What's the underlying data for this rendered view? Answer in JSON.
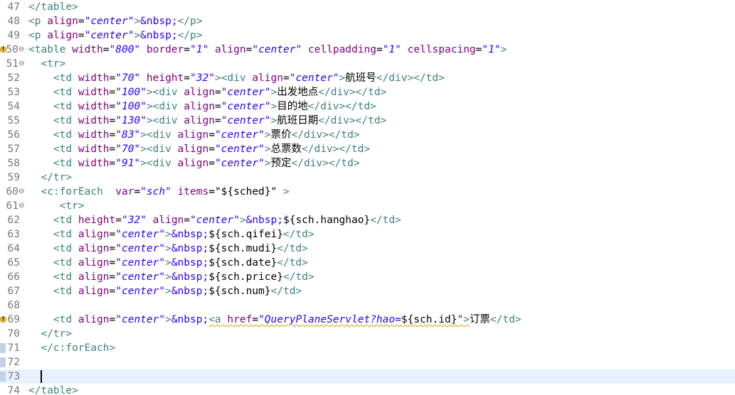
{
  "editor": {
    "caret_line": 72,
    "lines": [
      {
        "num": "47",
        "tokens": [
          [
            "tag",
            "</table>"
          ]
        ]
      },
      {
        "num": "48",
        "tokens": [
          [
            "tag",
            "<p "
          ],
          [
            "attr",
            "align"
          ],
          [
            "txt",
            "="
          ],
          [
            "val",
            "\"center\""
          ],
          [
            "tag",
            ">"
          ],
          [
            "ent",
            "&nbsp;"
          ],
          [
            "tag",
            "</p>"
          ]
        ]
      },
      {
        "num": "49",
        "tokens": [
          [
            "tag",
            "<p "
          ],
          [
            "attr",
            "align"
          ],
          [
            "txt",
            "="
          ],
          [
            "val",
            "\"center\""
          ],
          [
            "tag",
            ">"
          ],
          [
            "ent",
            "&nbsp;"
          ],
          [
            "tag",
            "</p>"
          ]
        ]
      },
      {
        "num": "50",
        "fold": "⊖",
        "warning": true,
        "tokens": [
          [
            "tag",
            "<table "
          ],
          [
            "attr",
            "width"
          ],
          [
            "txt",
            "="
          ],
          [
            "val",
            "\"800\""
          ],
          [
            "txt",
            " "
          ],
          [
            "attr",
            "border"
          ],
          [
            "txt",
            "="
          ],
          [
            "val",
            "\"1\""
          ],
          [
            "txt",
            " "
          ],
          [
            "attr",
            "align"
          ],
          [
            "txt",
            "="
          ],
          [
            "val",
            "\"center\""
          ],
          [
            "txt",
            " "
          ],
          [
            "attr",
            "cellpadding"
          ],
          [
            "txt",
            "="
          ],
          [
            "val",
            "\"1\""
          ],
          [
            "txt",
            " "
          ],
          [
            "attr",
            "cellspacing"
          ],
          [
            "txt",
            "="
          ],
          [
            "val",
            "\"1\""
          ],
          [
            "tag",
            ">"
          ]
        ]
      },
      {
        "num": "51",
        "fold": "⊖",
        "tokens": [
          [
            "txt",
            "  "
          ],
          [
            "tag",
            "<tr>"
          ]
        ]
      },
      {
        "num": "52",
        "tokens": [
          [
            "txt",
            "    "
          ],
          [
            "tag",
            "<td "
          ],
          [
            "attr",
            "width"
          ],
          [
            "txt",
            "="
          ],
          [
            "val",
            "\"70\""
          ],
          [
            "txt",
            " "
          ],
          [
            "attr",
            "height"
          ],
          [
            "txt",
            "="
          ],
          [
            "val",
            "\"32\""
          ],
          [
            "tag",
            "><div "
          ],
          [
            "attr",
            "align"
          ],
          [
            "txt",
            "="
          ],
          [
            "val",
            "\"center\""
          ],
          [
            "tag",
            ">"
          ],
          [
            "txt",
            "航班号"
          ],
          [
            "tag",
            "</div></td>"
          ]
        ]
      },
      {
        "num": "53",
        "tokens": [
          [
            "txt",
            "    "
          ],
          [
            "tag",
            "<td "
          ],
          [
            "attr",
            "width"
          ],
          [
            "txt",
            "="
          ],
          [
            "val",
            "\"100\""
          ],
          [
            "tag",
            "><div "
          ],
          [
            "attr",
            "align"
          ],
          [
            "txt",
            "="
          ],
          [
            "val",
            "\"center\""
          ],
          [
            "tag",
            ">"
          ],
          [
            "txt",
            "出发地点"
          ],
          [
            "tag",
            "</div></td>"
          ]
        ]
      },
      {
        "num": "54",
        "tokens": [
          [
            "txt",
            "    "
          ],
          [
            "tag",
            "<td "
          ],
          [
            "attr",
            "width"
          ],
          [
            "txt",
            "="
          ],
          [
            "val",
            "\"100\""
          ],
          [
            "tag",
            "><div "
          ],
          [
            "attr",
            "align"
          ],
          [
            "txt",
            "="
          ],
          [
            "val",
            "\"center\""
          ],
          [
            "tag",
            ">"
          ],
          [
            "txt",
            "目的地"
          ],
          [
            "tag",
            "</div></td>"
          ]
        ]
      },
      {
        "num": "55",
        "tokens": [
          [
            "txt",
            "    "
          ],
          [
            "tag",
            "<td "
          ],
          [
            "attr",
            "width"
          ],
          [
            "txt",
            "="
          ],
          [
            "val",
            "\"130\""
          ],
          [
            "tag",
            "><div "
          ],
          [
            "attr",
            "align"
          ],
          [
            "txt",
            "="
          ],
          [
            "val",
            "\"center\""
          ],
          [
            "tag",
            ">"
          ],
          [
            "txt",
            "航班日期"
          ],
          [
            "tag",
            "</div></td>"
          ]
        ]
      },
      {
        "num": "56",
        "tokens": [
          [
            "txt",
            "    "
          ],
          [
            "tag",
            "<td "
          ],
          [
            "attr",
            "width"
          ],
          [
            "txt",
            "="
          ],
          [
            "val",
            "\"83\""
          ],
          [
            "tag",
            "><div "
          ],
          [
            "attr",
            "align"
          ],
          [
            "txt",
            "="
          ],
          [
            "val",
            "\"center\""
          ],
          [
            "tag",
            ">"
          ],
          [
            "txt",
            "票价"
          ],
          [
            "tag",
            "</div></td>"
          ]
        ]
      },
      {
        "num": "57",
        "tokens": [
          [
            "txt",
            "    "
          ],
          [
            "tag",
            "<td "
          ],
          [
            "attr",
            "width"
          ],
          [
            "txt",
            "="
          ],
          [
            "val",
            "\"70\""
          ],
          [
            "tag",
            "><div "
          ],
          [
            "attr",
            "align"
          ],
          [
            "txt",
            "="
          ],
          [
            "val",
            "\"center\""
          ],
          [
            "tag",
            ">"
          ],
          [
            "txt",
            "总票数"
          ],
          [
            "tag",
            "</div></td>"
          ]
        ]
      },
      {
        "num": "58",
        "tokens": [
          [
            "txt",
            "    "
          ],
          [
            "tag",
            "<td "
          ],
          [
            "attr",
            "width"
          ],
          [
            "txt",
            "="
          ],
          [
            "val",
            "\"91\""
          ],
          [
            "tag",
            "><div "
          ],
          [
            "attr",
            "align"
          ],
          [
            "txt",
            "="
          ],
          [
            "val",
            "\"center\""
          ],
          [
            "tag",
            ">"
          ],
          [
            "txt",
            "预定"
          ],
          [
            "tag",
            "</div></td>"
          ]
        ]
      },
      {
        "num": "59",
        "tokens": [
          [
            "txt",
            "  "
          ],
          [
            "tag",
            "</tr>"
          ]
        ]
      },
      {
        "num": "60",
        "fold": "⊖",
        "tokens": [
          [
            "txt",
            "  "
          ],
          [
            "tag",
            "<c:forEach  "
          ],
          [
            "attr",
            "var"
          ],
          [
            "txt",
            "="
          ],
          [
            "val",
            "\"sch\""
          ],
          [
            "txt",
            " "
          ],
          [
            "attr",
            "items"
          ],
          [
            "txt",
            "="
          ],
          [
            "txt",
            "\"${sched}\""
          ],
          [
            "tag",
            " >"
          ]
        ]
      },
      {
        "num": "61",
        "fold": "⊖",
        "tokens": [
          [
            "txt",
            "     "
          ],
          [
            "tag",
            "<tr>"
          ]
        ]
      },
      {
        "num": "62",
        "tokens": [
          [
            "txt",
            "    "
          ],
          [
            "tag",
            "<td "
          ],
          [
            "attr",
            "height"
          ],
          [
            "txt",
            "="
          ],
          [
            "val",
            "\"32\""
          ],
          [
            "txt",
            " "
          ],
          [
            "attr",
            "align"
          ],
          [
            "txt",
            "="
          ],
          [
            "val",
            "\"center\""
          ],
          [
            "tag",
            ">"
          ],
          [
            "ent",
            "&nbsp;"
          ],
          [
            "txt",
            "${sch.hanghao}"
          ],
          [
            "tag",
            "</td>"
          ]
        ]
      },
      {
        "num": "63",
        "tokens": [
          [
            "txt",
            "    "
          ],
          [
            "tag",
            "<td "
          ],
          [
            "attr",
            "align"
          ],
          [
            "txt",
            "="
          ],
          [
            "val",
            "\"center\""
          ],
          [
            "tag",
            ">"
          ],
          [
            "ent",
            "&nbsp;"
          ],
          [
            "txt",
            "${sch.qifei}"
          ],
          [
            "tag",
            "</td>"
          ]
        ]
      },
      {
        "num": "64",
        "tokens": [
          [
            "txt",
            "    "
          ],
          [
            "tag",
            "<td "
          ],
          [
            "attr",
            "align"
          ],
          [
            "txt",
            "="
          ],
          [
            "val",
            "\"center\""
          ],
          [
            "tag",
            ">"
          ],
          [
            "ent",
            "&nbsp;"
          ],
          [
            "txt",
            "${sch.mudi}"
          ],
          [
            "tag",
            "</td>"
          ]
        ]
      },
      {
        "num": "65",
        "tokens": [
          [
            "txt",
            "    "
          ],
          [
            "tag",
            "<td "
          ],
          [
            "attr",
            "align"
          ],
          [
            "txt",
            "="
          ],
          [
            "val",
            "\"center\""
          ],
          [
            "tag",
            ">"
          ],
          [
            "ent",
            "&nbsp;"
          ],
          [
            "txt",
            "${sch.date}"
          ],
          [
            "tag",
            "</td>"
          ]
        ]
      },
      {
        "num": "66",
        "tokens": [
          [
            "txt",
            "    "
          ],
          [
            "tag",
            "<td "
          ],
          [
            "attr",
            "align"
          ],
          [
            "txt",
            "="
          ],
          [
            "val",
            "\"center\""
          ],
          [
            "tag",
            ">"
          ],
          [
            "ent",
            "&nbsp;"
          ],
          [
            "txt",
            "${sch.price}"
          ],
          [
            "tag",
            "</td>"
          ]
        ]
      },
      {
        "num": "67",
        "tokens": [
          [
            "txt",
            "    "
          ],
          [
            "tag",
            "<td "
          ],
          [
            "attr",
            "align"
          ],
          [
            "txt",
            "="
          ],
          [
            "val",
            "\"center\""
          ],
          [
            "tag",
            ">"
          ],
          [
            "ent",
            "&nbsp;"
          ],
          [
            "txt",
            "${sch.num}"
          ],
          [
            "tag",
            "</td>"
          ]
        ]
      },
      {
        "num": "68",
        "tokens": []
      },
      {
        "num": "69",
        "warning": true,
        "tokens": [
          [
            "txt",
            "    "
          ],
          [
            "tag",
            "<td "
          ],
          [
            "attr",
            "align"
          ],
          [
            "txt",
            "="
          ],
          [
            "val",
            "\"center\""
          ],
          [
            "tag",
            ">"
          ],
          [
            "ent",
            "&nbsp;"
          ],
          [
            "tag",
            "<a ",
            true
          ],
          [
            "attr",
            "href",
            true
          ],
          [
            "txt",
            "=",
            true
          ],
          [
            "val",
            "\"QueryPlaneServlet?hao=",
            true
          ],
          [
            "txt",
            "${sch.id}",
            true
          ],
          [
            "val",
            "\"",
            true
          ],
          [
            "tag",
            ">",
            true
          ],
          [
            "txt",
            "订票"
          ],
          [
            "tag",
            "</td>"
          ]
        ]
      },
      {
        "num": "70",
        "tokens": [
          [
            "txt",
            "  "
          ],
          [
            "tag",
            "</tr>"
          ]
        ]
      },
      {
        "num": "71",
        "marker": true,
        "tokens": [
          [
            "txt",
            "  "
          ],
          [
            "tag",
            "</c:forEach>"
          ]
        ]
      },
      {
        "num": "72",
        "marker": true,
        "tokens": []
      },
      {
        "num": "73",
        "marker": true,
        "current": true,
        "caret": true,
        "tokens": []
      },
      {
        "num": "74",
        "tokens": [
          [
            "tag",
            "</table>"
          ]
        ]
      }
    ]
  }
}
